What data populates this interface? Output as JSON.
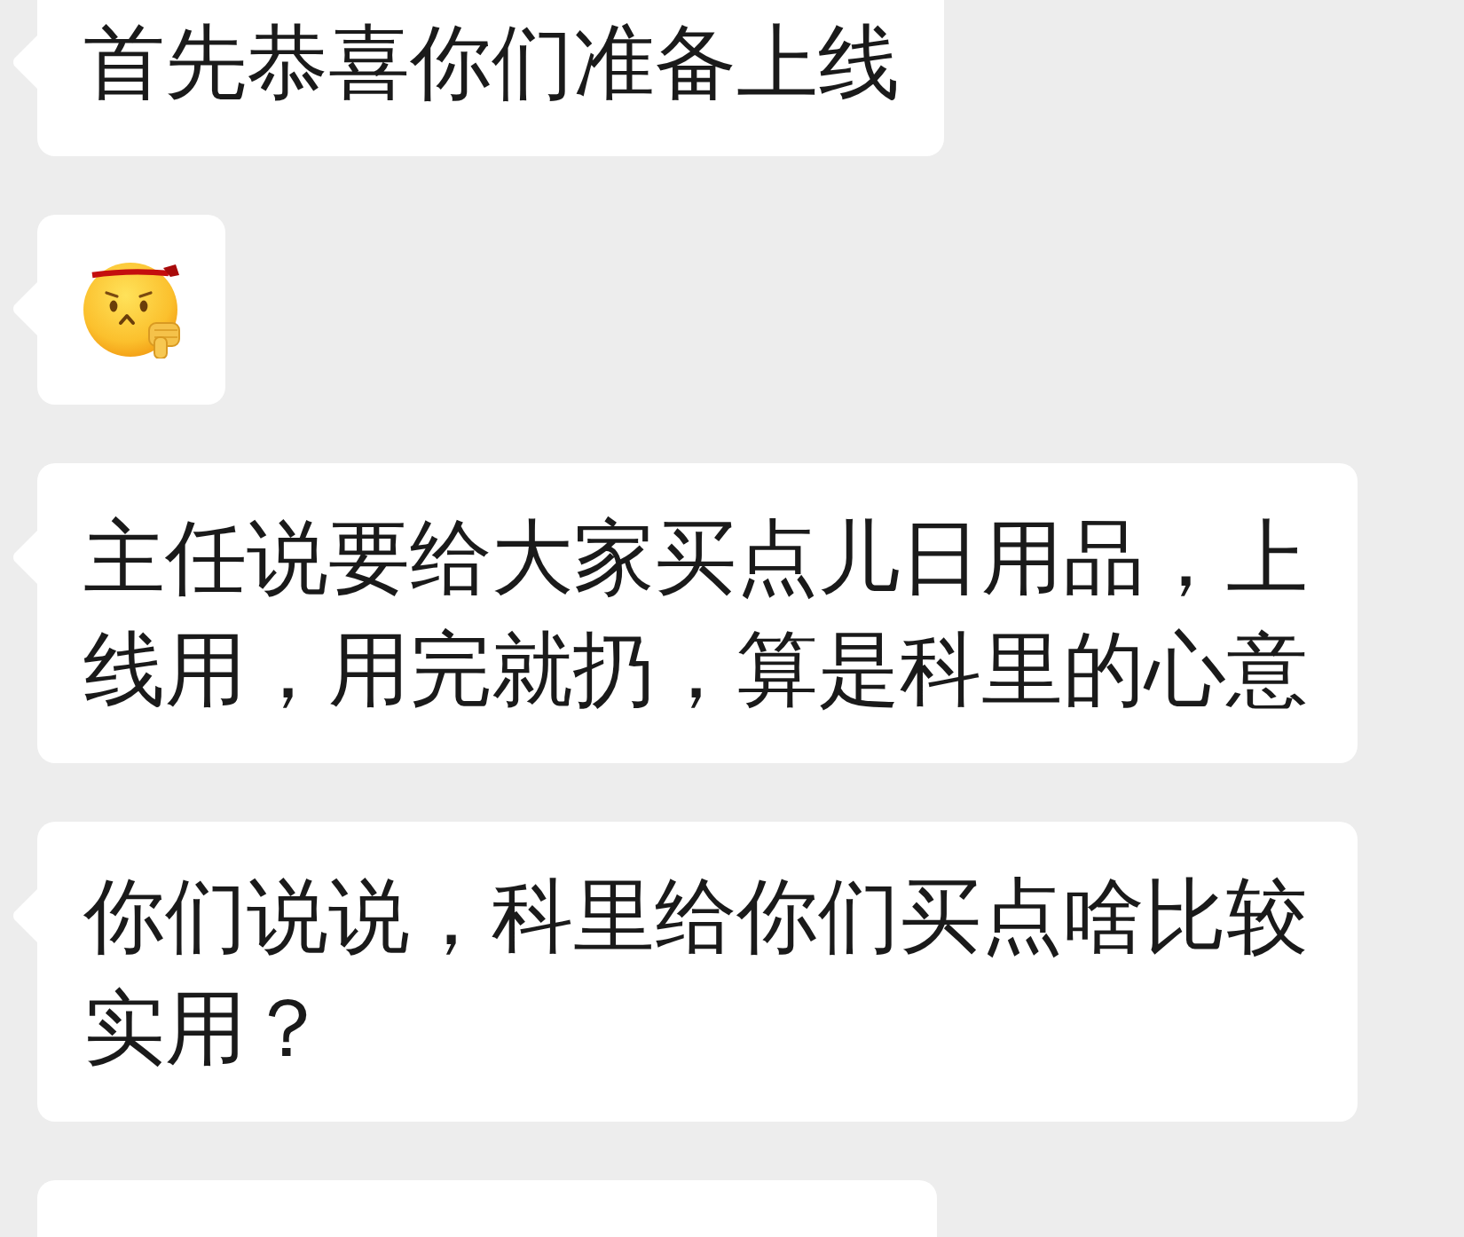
{
  "messages": [
    {
      "kind": "text",
      "text": "首先恭喜你们准备上线"
    },
    {
      "kind": "emoji"
    },
    {
      "kind": "text",
      "text": "主任说要给大家买点儿日用品，上线用，用完就扔，算是科里的心意"
    },
    {
      "kind": "text",
      "text": "你们说说，科里给你们买点啥比较实用？"
    },
    {
      "kind": "clipped"
    }
  ]
}
